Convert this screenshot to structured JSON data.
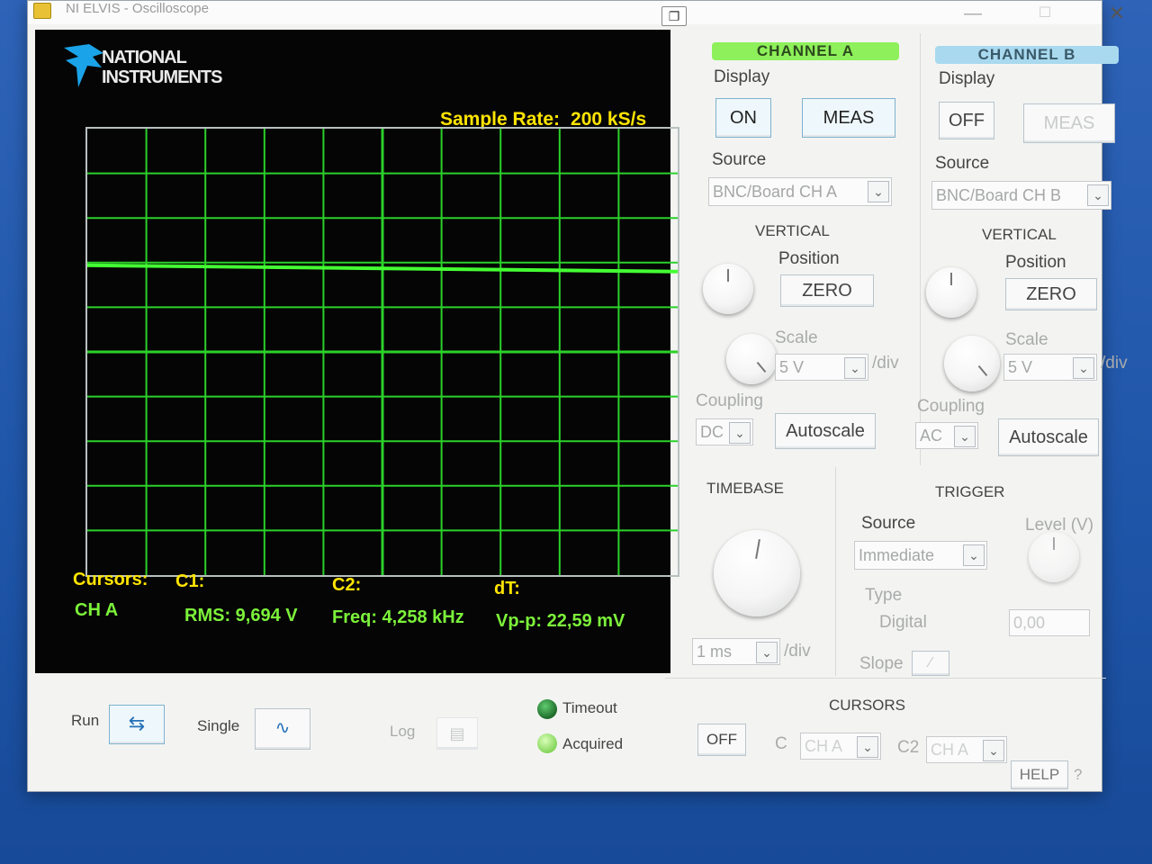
{
  "window": {
    "title": "NI ELVIS - Oscilloscope"
  },
  "display": {
    "logo_line1": "NATIONAL",
    "logo_line2": "INSTRUMENTS",
    "sample_rate_label": "Sample Rate:",
    "sample_rate_value": "200 kS/s",
    "readouts": {
      "cursors_label": "Cursors:",
      "cursors_value": "CH A",
      "c1_label": "C1:",
      "c1_value": "RMS: 9,694 V",
      "c2_label": "C2:",
      "c2_value": "Freq:  4,258 kHz",
      "dt_label": "dT:",
      "dt_value": "Vp-p:  22,59 mV"
    }
  },
  "channel_a": {
    "header": "CHANNEL A",
    "display_label": "Display",
    "on_label": "ON",
    "meas_label": "MEAS",
    "source_label": "Source",
    "source_value": "BNC/Board CH A",
    "vertical_label": "VERTICAL",
    "position_label": "Position",
    "zero_label": "ZERO",
    "scale_label": "Scale",
    "scale_value": "5 V",
    "scale_unit": "/div",
    "coupling_label": "Coupling",
    "coupling_value": "DC",
    "autoscale_label": "Autoscale"
  },
  "channel_b": {
    "header": "CHANNEL B",
    "display_label": "Display",
    "off_label": "OFF",
    "meas_label": "MEAS",
    "source_label": "Source",
    "source_value": "BNC/Board CH B",
    "vertical_label": "VERTICAL",
    "position_label": "Position",
    "zero_label": "ZERO",
    "scale_label": "Scale",
    "scale_value": "5 V",
    "scale_unit": "/div",
    "coupling_label": "Coupling",
    "coupling_value": "AC",
    "autoscale_label": "Autoscale"
  },
  "timebase": {
    "label": "TIMEBASE",
    "value": "1 ms",
    "unit": "/div"
  },
  "trigger": {
    "label": "TRIGGER",
    "source_label": "Source",
    "source_value": "Immediate",
    "level_label": "Level (V)",
    "level_value": "0,00",
    "type_label": "Type",
    "type_value": "Digital",
    "slope_label": "Slope"
  },
  "bottom": {
    "run_label": "Run",
    "single_label": "Single",
    "log_label": "Log",
    "timeout_label": "Timeout",
    "acquired_label": "Acquired"
  },
  "cursors": {
    "label": "CURSORS",
    "off_label": "OFF",
    "c1_label": "C",
    "c1_value": "CH A",
    "c2_label": "C2",
    "c2_value": "CH A"
  },
  "help": {
    "label": "HELP",
    "question": "?"
  },
  "colors": {
    "trace": "#44ff33",
    "grid": "#2bd12a",
    "readout_yellow": "#ffe400",
    "readout_green": "#7cf23a",
    "channel_a_header": "#8ef05a",
    "channel_b_header": "#a9d9ef"
  },
  "icons": {
    "run": "loop-arrows-icon",
    "single": "single-wave-icon",
    "log": "save-disk-icon"
  }
}
